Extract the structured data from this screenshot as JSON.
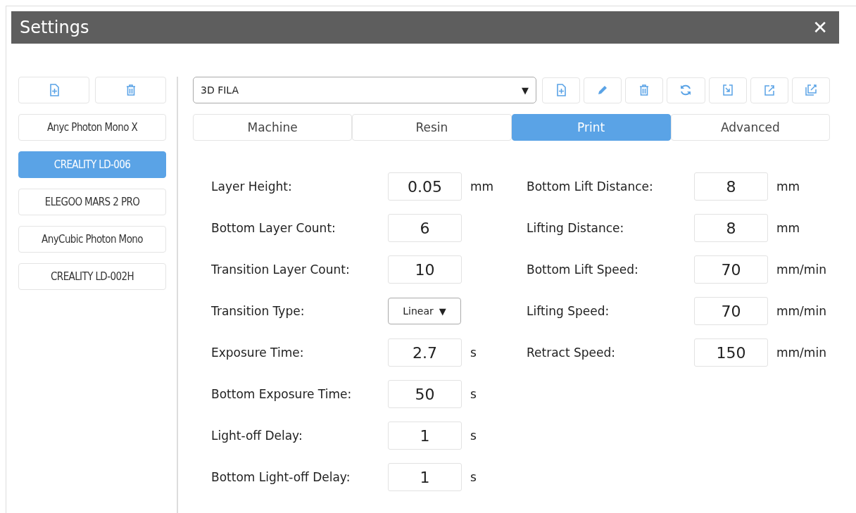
{
  "window": {
    "title": "Settings",
    "close": "✕"
  },
  "sidebar": {
    "toolbar": [
      {
        "kind": "add"
      },
      {
        "kind": "delete"
      }
    ],
    "items": [
      {
        "label": "Anyc Photon Mono X",
        "selected": false
      },
      {
        "label": "CREALITY LD-006",
        "selected": true
      },
      {
        "label": "ELEGOO MARS 2 PRO",
        "selected": false
      },
      {
        "label": "AnyCubic Photon Mono",
        "selected": false
      },
      {
        "label": "CREALITY LD-002H",
        "selected": false
      }
    ]
  },
  "profile": {
    "value": "3D FILA",
    "arrow": "▼"
  },
  "toolbar": [
    {
      "kind": "add"
    },
    {
      "kind": "edit"
    },
    {
      "kind": "delete"
    },
    {
      "kind": "refresh"
    },
    {
      "kind": "import"
    },
    {
      "kind": "export"
    },
    {
      "kind": "export_all"
    }
  ],
  "tabs": [
    {
      "label": "Machine",
      "selected": false
    },
    {
      "label": "Resin",
      "selected": false
    },
    {
      "label": "Print",
      "selected": true
    },
    {
      "label": "Advanced",
      "selected": false
    }
  ],
  "left_fields": [
    {
      "kind": "text",
      "label": "Layer Height:",
      "value": "0.05",
      "unit": "mm"
    },
    {
      "kind": "text",
      "label": "Bottom Layer Count:",
      "value": "6"
    },
    {
      "kind": "text",
      "label": "Transition Layer Count:",
      "value": "10"
    },
    {
      "kind": "select",
      "label": "Transition Type:",
      "value": "Linear",
      "arrow": "▼"
    },
    {
      "kind": "text",
      "label": "Exposure Time:",
      "value": "2.7",
      "unit": "s"
    },
    {
      "kind": "text",
      "label": "Bottom Exposure Time:",
      "value": "50",
      "unit": "s"
    },
    {
      "kind": "text",
      "label": "Light-off Delay:",
      "value": "1",
      "unit": "s"
    },
    {
      "kind": "text",
      "label": "Bottom Light-off Delay:",
      "value": "1",
      "unit": "s"
    }
  ],
  "right_fields": [
    {
      "kind": "text",
      "label": "Bottom Lift Distance:",
      "value": "8",
      "unit": "mm"
    },
    {
      "kind": "text",
      "label": "Lifting Distance:",
      "value": "8",
      "unit": "mm"
    },
    {
      "kind": "text",
      "label": "Bottom Lift Speed:",
      "value": "70",
      "unit": "mm/min"
    },
    {
      "kind": "text",
      "label": "Lifting Speed:",
      "value": "70",
      "unit": "mm/min"
    },
    {
      "kind": "text",
      "label": "Retract Speed:",
      "value": "150",
      "unit": "mm/min"
    }
  ]
}
